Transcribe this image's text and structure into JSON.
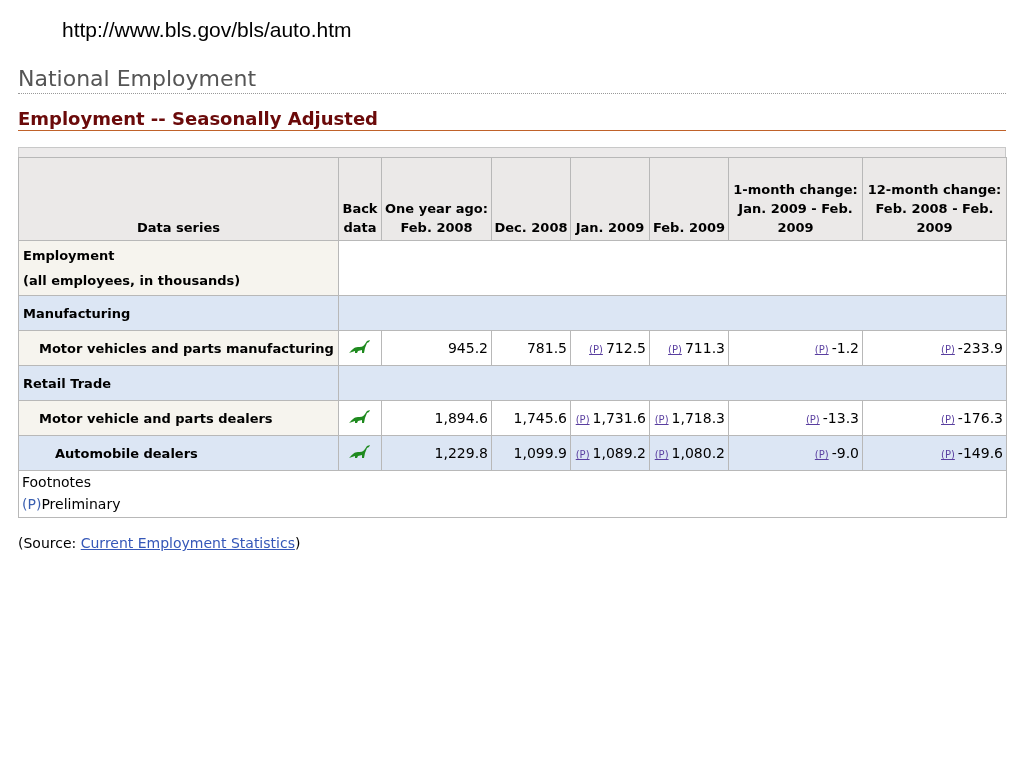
{
  "url": "http://www.bls.gov/bls/auto.htm",
  "page_title": "National Employment",
  "section_title": "Employment -- Seasonally Adjusted",
  "table": {
    "columns": [
      {
        "label": "Data series"
      },
      {
        "label": "Back data"
      },
      {
        "label": "One year ago: Feb. 2008"
      },
      {
        "label": "Dec. 2008"
      },
      {
        "label": "Jan. 2009"
      },
      {
        "label": "Feb. 2009"
      },
      {
        "label": "1-month change: Jan. 2009 - Feb. 2009"
      },
      {
        "label": "12-month change: Feb. 2008 - Feb. 2009"
      }
    ],
    "rows": [
      {
        "kind": "group",
        "label": "Employment",
        "detail": "(all employees, in thousands)"
      },
      {
        "kind": "group",
        "label": "Manufacturing",
        "children": [
          {
            "kind": "series",
            "label": "Motor vehicles and parts manufacturing",
            "cells": [
              {
                "value": "945.2"
              },
              {
                "value": "781.5"
              },
              {
                "note": "(P)",
                "value": "712.5"
              },
              {
                "note": "(P)",
                "value": "711.3"
              },
              {
                "note": "(P)",
                "value": "-1.2"
              },
              {
                "note": "(P)",
                "value": "-233.9"
              }
            ]
          }
        ]
      },
      {
        "kind": "group",
        "label": "Retail Trade",
        "children": [
          {
            "kind": "series",
            "label": "Motor vehicle and parts dealers",
            "cells": [
              {
                "value": "1,894.6"
              },
              {
                "value": "1,745.6"
              },
              {
                "note": "(P)",
                "value": "1,731.6"
              },
              {
                "note": "(P)",
                "value": "1,718.3"
              },
              {
                "note": "(P)",
                "value": "-13.3"
              },
              {
                "note": "(P)",
                "value": "-176.3"
              }
            ],
            "children": [
              {
                "kind": "series",
                "label": "Automobile dealers",
                "cells": [
                  {
                    "value": "1,229.8"
                  },
                  {
                    "value": "1,099.9"
                  },
                  {
                    "note": "(P)",
                    "value": "1,089.2"
                  },
                  {
                    "note": "(P)",
                    "value": "1,080.2"
                  },
                  {
                    "note": "(P)",
                    "value": "-9.0"
                  },
                  {
                    "note": "(P)",
                    "value": "-149.6"
                  }
                ]
              }
            ]
          }
        ]
      }
    ],
    "footnotes": {
      "title": "Footnotes",
      "items": [
        {
          "mark": "(P)",
          "text": "Preliminary"
        }
      ]
    }
  },
  "source": {
    "prefix": "(Source: ",
    "link": "Current Employment Statistics",
    "suffix": ")"
  }
}
